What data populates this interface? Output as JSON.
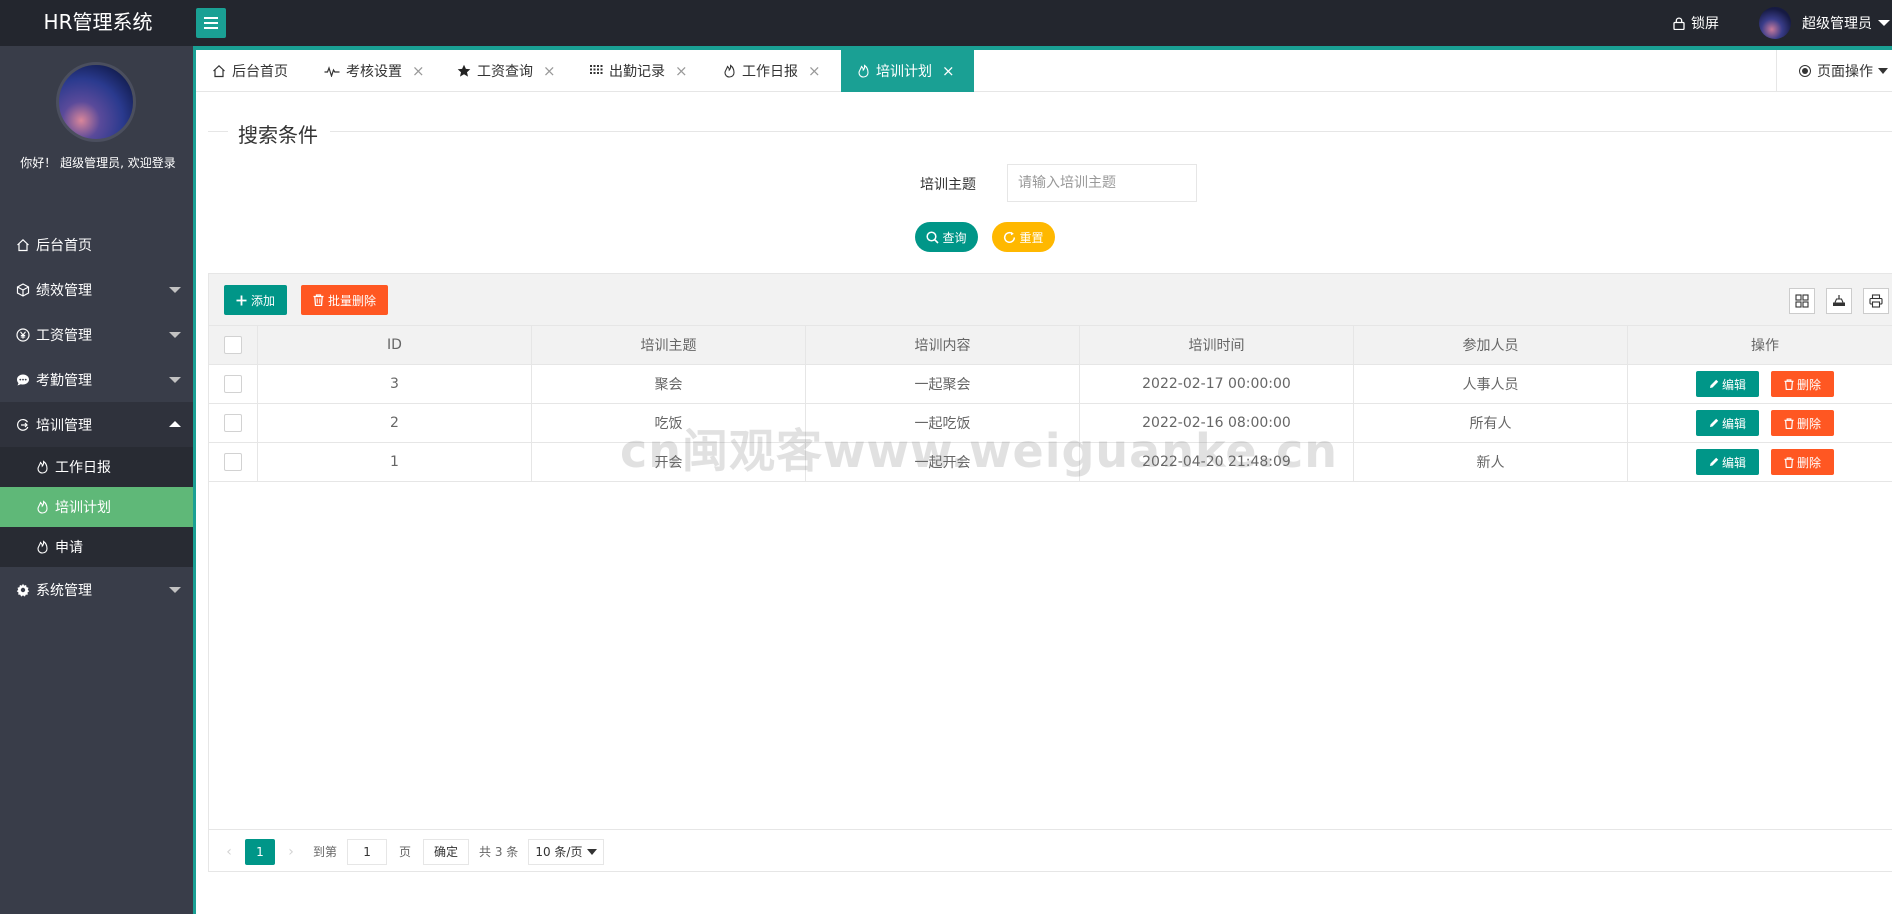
{
  "app": {
    "title": "HR管理系统",
    "lock_label": "锁屏",
    "user_name": "超级管理员",
    "welcome": "你好！ 超级管理员, 欢迎登录",
    "accent_color": "#1aa094",
    "active_menu_color": "#5fb878"
  },
  "sidebar": {
    "items": [
      {
        "label": "后台首页",
        "icon": "home-icon"
      },
      {
        "label": "绩效管理",
        "icon": "cube-icon"
      },
      {
        "label": "工资管理",
        "icon": "yen-icon"
      },
      {
        "label": "考勤管理",
        "icon": "chat-icon"
      },
      {
        "label": "培训管理",
        "icon": "training-icon"
      },
      {
        "label": "系统管理",
        "icon": "gear-icon"
      }
    ],
    "sub_items": [
      {
        "label": "工作日报",
        "icon": "fire-icon"
      },
      {
        "label": "培训计划",
        "icon": "fire-icon"
      },
      {
        "label": "申请",
        "icon": "fire-icon"
      }
    ]
  },
  "tabs": [
    {
      "label": "后台首页",
      "icon": "home-icon"
    },
    {
      "label": "考核设置",
      "icon": "pulse-icon"
    },
    {
      "label": "工资查询",
      "icon": "star-icon"
    },
    {
      "label": "出勤记录",
      "icon": "grid-icon"
    },
    {
      "label": "工作日报",
      "icon": "fire-icon"
    },
    {
      "label": "培训计划",
      "icon": "fire-icon"
    }
  ],
  "page_op_label": "页面操作",
  "search": {
    "legend": "搜索条件",
    "label": "培训主题",
    "placeholder": "请输入培训主题",
    "query_label": "查询",
    "reset_label": "重置"
  },
  "toolbar": {
    "add_label": "添加",
    "batch_delete_label": "批量删除"
  },
  "table": {
    "columns": [
      "ID",
      "培训主题",
      "培训内容",
      "培训时间",
      "参加人员",
      "操作"
    ],
    "rows": [
      {
        "id": "3",
        "topic": "聚会",
        "content": "一起聚会",
        "time": "2022-02-17 00:00:00",
        "people": "人事人员"
      },
      {
        "id": "2",
        "topic": "吃饭",
        "content": "一起吃饭",
        "time": "2022-02-16 08:00:00",
        "people": "所有人"
      },
      {
        "id": "1",
        "topic": "开会",
        "content": "一起开会",
        "time": "2022-04-20 21:48:09",
        "people": "新人"
      }
    ],
    "edit_label": "编辑",
    "delete_label": "删除"
  },
  "pager": {
    "current_page": "1",
    "goto_label": "到第",
    "goto_value": "1",
    "page_unit": "页",
    "confirm_label": "确定",
    "total_label": "共 3 条",
    "page_size_label": "10 条/页"
  },
  "watermark": "cn闽观客www.weiguanke.cn"
}
